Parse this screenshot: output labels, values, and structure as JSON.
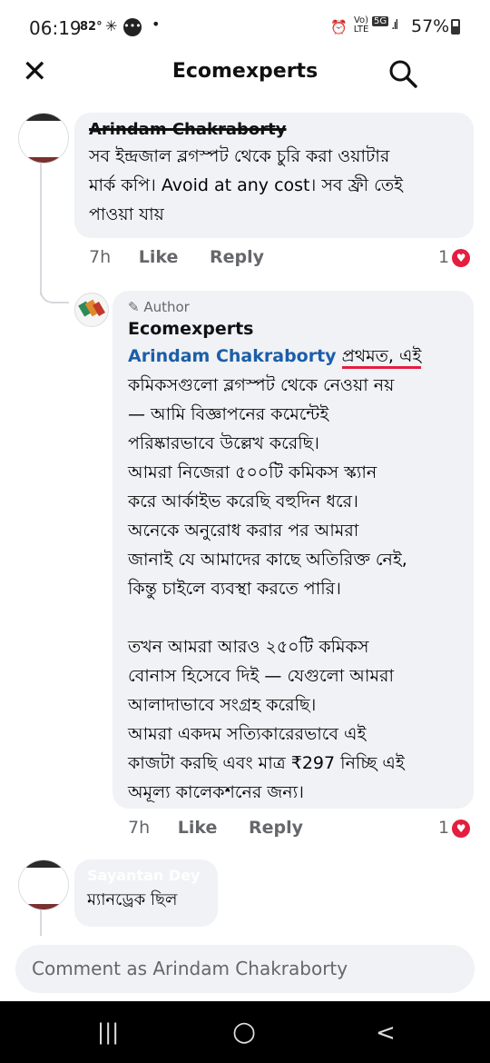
{
  "status": {
    "time": "06:19",
    "temp": "82°",
    "battery": "57%",
    "network": "5G",
    "volte": "Vo) LTE"
  },
  "header": {
    "title": "Ecomexperts"
  },
  "comments": [
    {
      "author": "Arindam Chakraborty",
      "text_lines": [
        "সব ইন্দ্রজাল ব্লগস্পট থেকে চুরি করা ওয়াটার",
        "মার্ক কপি। Avoid at any cost। সব ফ্রী তেই",
        "পাওয়া যায়"
      ],
      "time": "7h",
      "like": "Like",
      "reply": "Reply",
      "reactions": "1"
    },
    {
      "badge": "Author",
      "author": "Ecomexperts",
      "mention": "Arindam Chakraborty",
      "first_word": "প্রথমত",
      "first_rest": ", এই",
      "text_lines": [
        "কমিকসগুলো ব্লগস্পট থেকে নেওয়া নয়",
        "— আমি বিজ্ঞাপনের কমেন্টেই",
        "পরিষ্কারভাবে উল্লেখ করেছি।",
        "আমরা নিজেরা ৫০০টি কমিকস স্ক্যান",
        "করে আর্কাইভ করেছি বহুদিন ধরে।",
        "অনেকে অনুরোধ করার পর আমরা",
        "জানাই যে আমাদের কাছে অতিরিক্ত নেই,",
        "কিন্তু চাইলে ব্যবস্থা করতে পারি।",
        "",
        "তখন আমরা আরও ২৫০টি কমিকস",
        "বোনাস হিসেবে দিই — যেগুলো আমরা",
        "আলাদাভাবে সংগ্রহ করেছি।",
        "আমরা একদম সত্যিকারেরভাবে এই",
        "কাজটা করছি এবং মাত্র ₹297 নিচ্ছি এই",
        "অমূল্য কালেকশনের জন্য।"
      ],
      "time": "7h",
      "like": "Like",
      "reply": "Reply",
      "reactions": "1"
    },
    {
      "author": "Sayantan Dey",
      "text_lines": [
        "ম্যানড্রেক ছিল"
      ]
    }
  ],
  "composer": {
    "placeholder": "Comment as Arindam Chakraborty"
  },
  "nav": {
    "recents": "|||",
    "home": "○",
    "back": "<"
  },
  "colors": {
    "link": "#1c5ea8",
    "heart": "#e41e3f",
    "bubble": "#f0f2f5",
    "muted": "#65676b"
  }
}
